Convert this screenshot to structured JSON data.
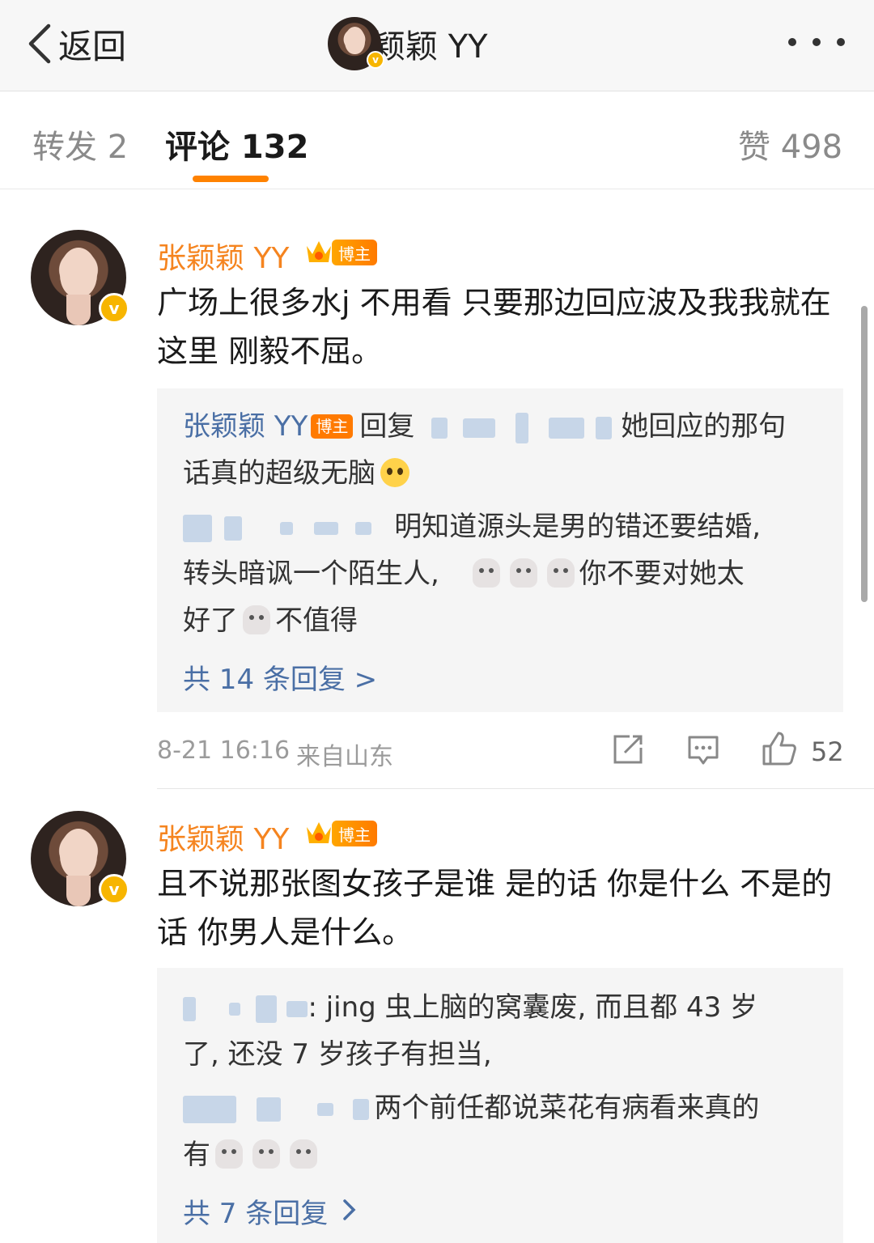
{
  "nav": {
    "back_label": "返回",
    "title": "张颖颖 YY"
  },
  "tabs": {
    "reposts": "转发 2",
    "comments": "评论 132",
    "likes": "赞 498"
  },
  "colors": {
    "accent": "#ff8200",
    "name": "#f5841f",
    "link": "#4a6fa5",
    "verified": "#f7b500"
  },
  "comments": [
    {
      "author": "张颖颖 YY",
      "badge": "博主",
      "text": "广场上很多水j 不用看 只要那边回应波及我我就在这里 刚毅不屈。",
      "replies": [
        {
          "author": "张颖颖 YY",
          "badge": "博主",
          "prefix": "回复",
          "text_line1": "她回应的那句",
          "text_line2": "话真的超级无脑"
        },
        {
          "text_line1": "明知道源头是男的错还要结婚,",
          "text_line2": "转头暗讽一个陌生人,",
          "text_line2b": "你不要对她太",
          "text_line3": "好了",
          "text_line3b": "不值得"
        }
      ],
      "more_replies": "共 14 条回复 >",
      "time": "8-21 16:16",
      "location": "来自山东",
      "likes": "52"
    },
    {
      "author": "张颖颖 YY",
      "badge": "博主",
      "text": "且不说那张图女孩子是谁 是的话 你是什么 不是的话 你男人是什么。",
      "replies": [
        {
          "text_line1": ": jing 虫上脑的窝囊废, 而且都 43 岁",
          "text_line2": "了, 还没 7 岁孩子有担当,"
        },
        {
          "text_line1": "两个前任都说菜花有病看来真的",
          "text_line2": "有"
        }
      ],
      "more_replies": "共 7 条回复"
    }
  ]
}
